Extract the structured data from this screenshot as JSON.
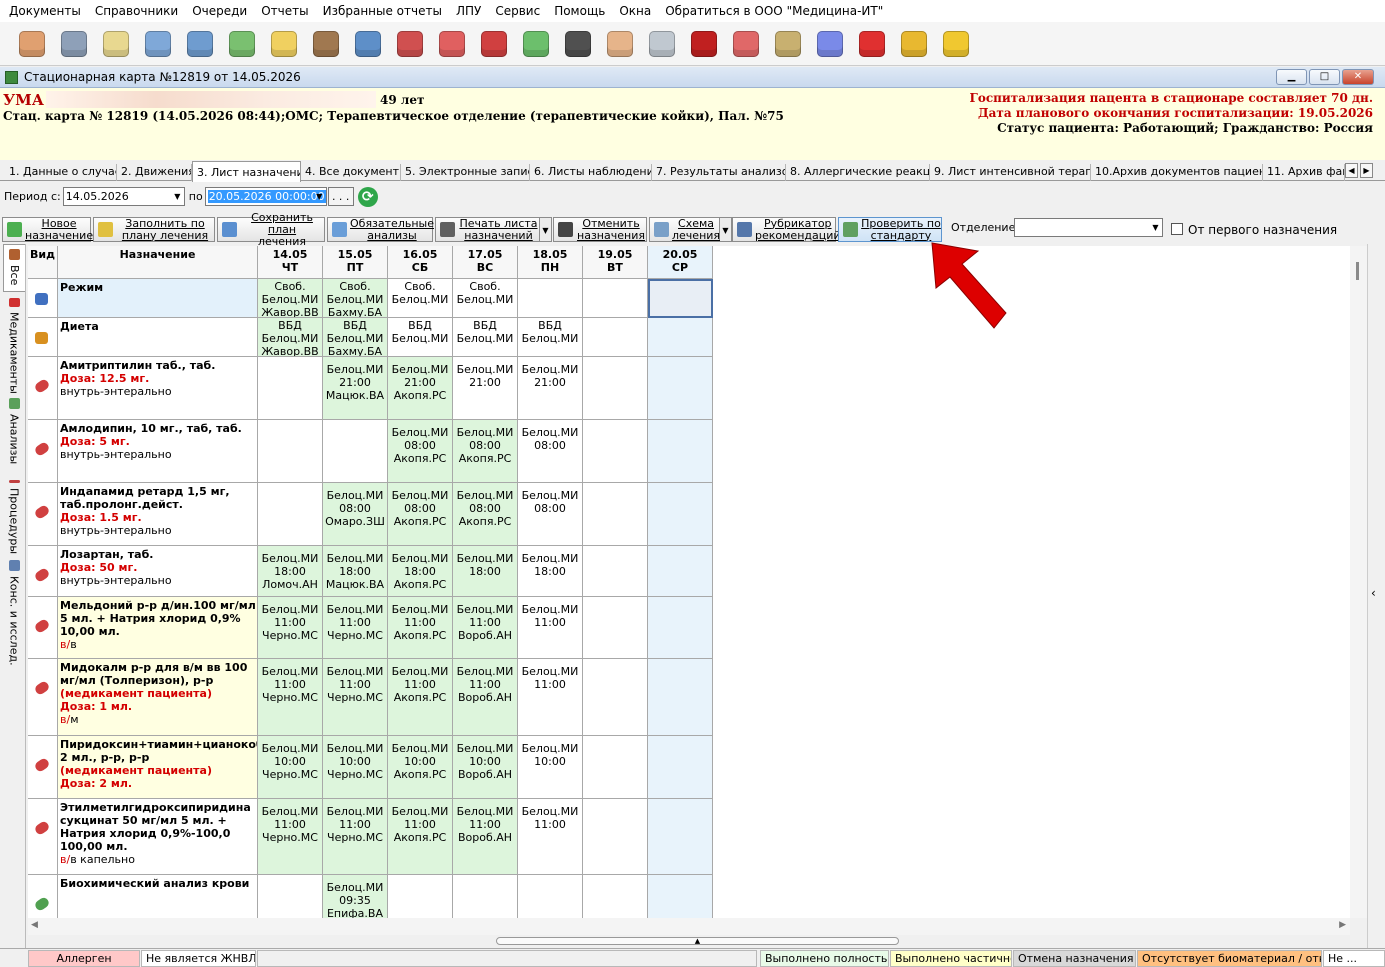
{
  "menu": [
    "Документы",
    "Справочники",
    "Очереди",
    "Отчеты",
    "Избранные отчеты",
    "ЛПУ",
    "Сервис",
    "Помощь",
    "Окна",
    "Обратиться в ООО \"Медицина-ИТ\""
  ],
  "toolbar_icons": [
    {
      "name": "doctor-icon",
      "color": "#e0a070"
    },
    {
      "name": "user-search-icon",
      "color": "#8ea0b8"
    },
    {
      "name": "journal-icon",
      "color": "#e8d890"
    },
    {
      "name": "patient-card-icon",
      "color": "#7fa8d8"
    },
    {
      "name": "id-card-icon",
      "color": "#6f9ccf"
    },
    {
      "name": "lab-flasks-icon",
      "color": "#7ac070"
    },
    {
      "name": "notepad-icon",
      "color": "#f0d060"
    },
    {
      "name": "archive-icon",
      "color": "#a07850"
    },
    {
      "name": "schedule-icon",
      "color": "#5e8fc8"
    },
    {
      "name": "medkit-icon",
      "color": "#d05050"
    },
    {
      "name": "medical-record-icon",
      "color": "#e06060"
    },
    {
      "name": "books-icon",
      "color": "#d04040"
    },
    {
      "name": "pill-icon",
      "color": "#6cbf6c"
    },
    {
      "name": "barcode-scanner-icon",
      "color": "#505050"
    },
    {
      "name": "nurse-icon",
      "color": "#e6b48a"
    },
    {
      "name": "thermometer-icon",
      "color": "#c0c8d0"
    },
    {
      "name": "red-book-icon",
      "color": "#c02020"
    },
    {
      "name": "calendar-clock-icon",
      "color": "#e06868"
    },
    {
      "name": "forms-icon",
      "color": "#c8b070"
    },
    {
      "name": "add-document-icon",
      "color": "#7a8ae8"
    },
    {
      "name": "apps-grid-icon",
      "color": "#e03030"
    },
    {
      "name": "lock-icon",
      "color": "#e8b830"
    },
    {
      "name": "chat-bubble-icon",
      "color": "#f0c830"
    }
  ],
  "window": {
    "title": "Стационарная карта №12819 от 14.05.2026",
    "minimize": "▁",
    "maximize": "□",
    "close": "✕"
  },
  "patient": {
    "name": "УМА",
    "age": "49 лет",
    "card": "Стац. карта  № 12819 (14.05.2026 08:44);ОМС; Терапевтическое отделение (терапевтические койки), Пал. №75",
    "hosp_duration": "Госпитализация пацента в стационаре составляет 70 дн.",
    "planned_end": "Дата планового окончания госпитализации: 19.05.2026",
    "status": "Статус пациента: Работающий; Гражданство: Россия"
  },
  "tabs": [
    "1. Данные о случае",
    "2. Движения",
    "3. Лист назначений",
    "4. Все документы",
    "5. Электронные записи",
    "6. Листы наблюдений",
    "7. Результаты анализов",
    "8. Аллергические реакции",
    "9. Лист интенсивной терапии",
    "10.Архив документов пациента",
    "11. Архив фай"
  ],
  "active_tab": 2,
  "period": {
    "from_label": "Период с:",
    "from": "14.05.2026",
    "to_label": "по",
    "to": "20.05.2026 00:00:00",
    "ellipsis": ". . ."
  },
  "actions": [
    {
      "l1": "Новое",
      "l2": "назначение",
      "color": "#4caf50"
    },
    {
      "l1": "Заполнить по",
      "l2": "плану лечения",
      "color": "#e0c040"
    },
    {
      "l1": "Сохранить план",
      "l2": "лечения",
      "color": "#5a8fd0"
    },
    {
      "l1": "Обязательные",
      "l2": "анализы",
      "color": "#6a9ed8"
    },
    {
      "l1": "Печать листа",
      "l2": "назначений",
      "color": "#606060"
    },
    {
      "l1": "Отменить",
      "l2": "назначения",
      "color": "#444444"
    },
    {
      "l1": "Схема",
      "l2": "лечения",
      "color": "#7aa0c8"
    },
    {
      "l1": "Рубрикатор",
      "l2": "рекомендаций",
      "color": "#5577aa"
    },
    {
      "l1": "Проверить по",
      "l2": "стандарту",
      "color": "#60a060"
    }
  ],
  "dept_label": "Отделение:",
  "first_label": "От первого назначения",
  "side_tabs": [
    {
      "label": "Все",
      "color": "#b06030"
    },
    {
      "label": "Медикаменты",
      "color": "#d03030"
    },
    {
      "label": "Анализы",
      "color": "#5aa05a"
    },
    {
      "label": "Процедуры",
      "color": "#c04040"
    },
    {
      "label": "Конс. и исслед.",
      "color": "#6080b0"
    }
  ],
  "grid": {
    "h_kind": "Вид",
    "h_name": "Назначение",
    "dates": [
      {
        "d": "14.05",
        "w": "ЧТ"
      },
      {
        "d": "15.05",
        "w": "ПТ"
      },
      {
        "d": "16.05",
        "w": "СБ"
      },
      {
        "d": "17.05",
        "w": "ВС"
      },
      {
        "d": "18.05",
        "w": "ПН"
      },
      {
        "d": "19.05",
        "w": "ВТ"
      },
      {
        "d": "20.05",
        "w": "СР"
      }
    ],
    "rows": [
      {
        "name": "Режим",
        "icon": "#4070c0",
        "bg": "#e3f1fb",
        "lines": [],
        "cells": [
          "Своб.\nБелоц.МИ\nЖавор.ВВ",
          "Своб.\nБелоц.МИ\nБахму.БА",
          "Своб.\nБелоц.МИ",
          "Своб.\nБелоц.МИ",
          "",
          "",
          ""
        ],
        "green": [
          1,
          1,
          0,
          0,
          0,
          0,
          0
        ]
      },
      {
        "name": "Диета",
        "icon": "#d89020",
        "bg": "#ffffff",
        "lines": [],
        "cells": [
          "ВБД\nБелоц.МИ\nЖавор.ВВ",
          "ВБД\nБелоц.МИ\nБахму.БА",
          "ВБД\nБелоц.МИ",
          "ВБД\nБелоц.МИ",
          "ВБД\nБелоц.МИ",
          "",
          ""
        ],
        "green": [
          1,
          1,
          0,
          0,
          0,
          0,
          0
        ]
      },
      {
        "name": "Амитриптилин таб., таб.",
        "icon": "#d04040",
        "bg": "#ffffff",
        "dose": "Доза: 12.5 мг.",
        "route": "внутрь-энтерально",
        "cells": [
          "",
          "Белоц.МИ\n21:00\nМацюк.ВА",
          "Белоц.МИ\n21:00\nАкопя.РС",
          "Белоц.МИ\n21:00",
          "Белоц.МИ\n21:00",
          "",
          ""
        ],
        "green": [
          0,
          1,
          1,
          0,
          0,
          0,
          0
        ]
      },
      {
        "name": "Амлодипин, 10 мг., таб, таб.",
        "icon": "#d04040",
        "bg": "#ffffff",
        "dose": "Доза: 5 мг.",
        "route": "внутрь-энтерально",
        "cells": [
          "",
          "",
          "Белоц.МИ\n08:00\nАкопя.РС",
          "Белоц.МИ\n08:00\nАкопя.РС",
          "Белоц.МИ\n08:00",
          "",
          ""
        ],
        "green": [
          0,
          0,
          1,
          1,
          0,
          0,
          0
        ]
      },
      {
        "name": "Индапамид ретард 1,5 мг, таб.пролонг.дейст.",
        "icon": "#d04040",
        "bg": "#ffffff",
        "dose": "Доза: 1.5 мг.",
        "route": "внутрь-энтерально",
        "cells": [
          "",
          "Белоц.МИ\n08:00\nОмаро.ЗШ",
          "Белоц.МИ\n08:00\nАкопя.РС",
          "Белоц.МИ\n08:00\nАкопя.РС",
          "Белоц.МИ\n08:00",
          "",
          ""
        ],
        "green": [
          0,
          1,
          1,
          1,
          0,
          0,
          0
        ]
      },
      {
        "name": "Лозартан, таб.",
        "icon": "#d04040",
        "bg": "#ffffff",
        "dose": "Доза: 50 мг.",
        "route": "внутрь-энтерально",
        "cells": [
          "Белоц.МИ\n18:00\nЛомоч.АН",
          "Белоц.МИ\n18:00\nМацюк.ВА",
          "Белоц.МИ\n18:00\nАкопя.РС",
          "Белоц.МИ\n18:00",
          "Белоц.МИ\n18:00",
          "",
          ""
        ],
        "green": [
          1,
          1,
          1,
          1,
          0,
          0,
          0
        ]
      },
      {
        "name": "Мельдоний р-р д/ин.100 мг/мл 5 мл. + Натрия хлорид 0,9% 10,00 мл.",
        "icon": "#d04040",
        "bg": "#ffffe1",
        "route_red": "в/",
        "route_tail": "в",
        "cells": [
          "Белоц.МИ\n11:00\nЧерно.МС",
          "Белоц.МИ\n11:00\nЧерно.МС",
          "Белоц.МИ\n11:00\nАкопя.РС",
          "Белоц.МИ\n11:00\nВороб.АН",
          "Белоц.МИ\n11:00",
          "",
          ""
        ],
        "green": [
          1,
          1,
          1,
          1,
          0,
          0,
          0
        ]
      },
      {
        "name": "Мидокалм р-р для в/м вв 100 мг/мл (Толперизон), р-р",
        "icon": "#d04040",
        "bg": "#ffffe1",
        "note": "(медикамент пациента)",
        "dose": "Доза: 1 мл.",
        "route_red": "в/",
        "route_tail": "м",
        "cells": [
          "Белоц.МИ\n11:00\nЧерно.МС",
          "Белоц.МИ\n11:00\nЧерно.МС",
          "Белоц.МИ\n11:00\nАкопя.РС",
          "Белоц.МИ\n11:00\nВороб.АН",
          "Белоц.МИ\n11:00",
          "",
          ""
        ],
        "green": [
          1,
          1,
          1,
          1,
          0,
          0,
          0
        ]
      },
      {
        "name": "Пиридоксин+тиамин+цианокобаламин+лидокаин, 2 мл., р-р, р-р",
        "icon": "#d04040",
        "bg": "#ffffe1",
        "note": "(медикамент пациента)",
        "dose": "Доза: 2 мл.",
        "cells": [
          "Белоц.МИ\n10:00\nЧерно.МС",
          "Белоц.МИ\n10:00\nЧерно.МС",
          "Белоц.МИ\n10:00\nАкопя.РС",
          "Белоц.МИ\n10:00\nВороб.АН",
          "Белоц.МИ\n10:00",
          "",
          ""
        ],
        "green": [
          1,
          1,
          1,
          1,
          0,
          0,
          0
        ]
      },
      {
        "name": "Этилметилгидроксипиридина сукцинат 50 мг/мл 5 мл. + Натрия хлорид 0,9%-100,0 100,00 мл.",
        "icon": "#d04040",
        "bg": "#ffffff",
        "route_red": "в/",
        "route_tail": "в капельно",
        "cells": [
          "Белоц.МИ\n11:00\nЧерно.МС",
          "Белоц.МИ\n11:00\nЧерно.МС",
          "Белоц.МИ\n11:00\nАкопя.РС",
          "Белоц.МИ\n11:00\nВороб.АН",
          "Белоц.МИ\n11:00",
          "",
          ""
        ],
        "green": [
          1,
          1,
          1,
          1,
          0,
          0,
          0
        ]
      },
      {
        "name": "Биохимический анализ крови",
        "icon": "#50a050",
        "bg": "#ffffff",
        "cells": [
          "",
          "Белоц.МИ\n09:35\nЕпифа.ВА",
          "",
          "",
          "",
          "",
          ""
        ],
        "green": [
          0,
          1,
          0,
          0,
          0,
          0,
          0
        ]
      }
    ]
  },
  "statusbar": [
    "Аллерген",
    "Не является ЖНВЛП",
    "",
    "Выполнено полностью",
    "Выполнено частично",
    "Отмена назначения",
    "Отсутствует биоматериал / отказ",
    "Не ..."
  ],
  "colors": {
    "done_green": "#ddf5dc",
    "current_col": "#e8f3fb",
    "allergen": "#ffc8c8",
    "partial": "#ffffc8",
    "cancel": "#d8d8d8",
    "absent": "#ffc080",
    "arrow": "#dd0000"
  }
}
